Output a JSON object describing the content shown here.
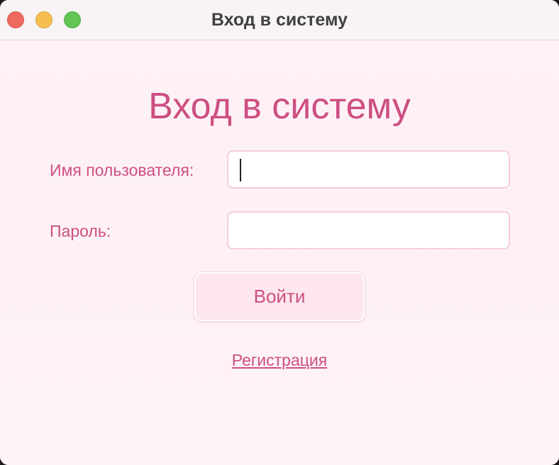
{
  "window": {
    "title": "Вход в систему"
  },
  "form": {
    "heading": "Вход в систему",
    "username_label": "Имя пользователя:",
    "username_value": "",
    "password_label": "Пароль:",
    "password_value": "",
    "login_button": "Войти",
    "register_link": "Регистрация"
  },
  "colors": {
    "accent": "#cd4f82",
    "background": "#fdeef3",
    "field_border": "#f6cdd9"
  }
}
